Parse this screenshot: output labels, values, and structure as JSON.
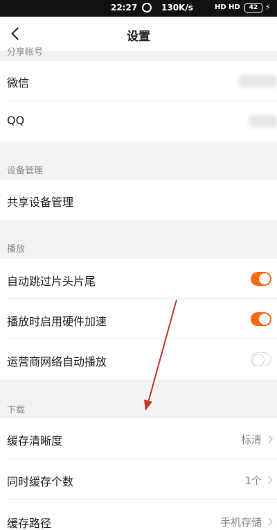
{
  "status": {
    "time": "22:27",
    "net_speed": "130K/s",
    "signal_1": "HD",
    "signal_2": "HD",
    "battery": "42"
  },
  "nav": {
    "title": "设置"
  },
  "sections": {
    "share_account": "分享帐号",
    "device": "设备管理",
    "play": "播放",
    "download": "下载"
  },
  "rows": {
    "wechat": "微信",
    "qq": "QQ",
    "share_device": "共享设备管理",
    "skip_intro": "自动跳过片头片尾",
    "hw_accel": "播放时启用硬件加速",
    "carrier_autoplay": "运营商网络自动播放",
    "cache_quality": "缓存清晰度",
    "cache_quality_value": "标清",
    "cache_count": "同时缓存个数",
    "cache_count_value": "1个",
    "cache_path": "缓存路径",
    "cache_path_value": "手机存储"
  },
  "toggles": {
    "skip_intro": true,
    "hw_accel": true,
    "carrier_autoplay": false
  },
  "colors": {
    "accent": "#ff6a13"
  },
  "icons": {
    "back": "chevron-left-icon",
    "row_more": "chevron-right-icon"
  }
}
